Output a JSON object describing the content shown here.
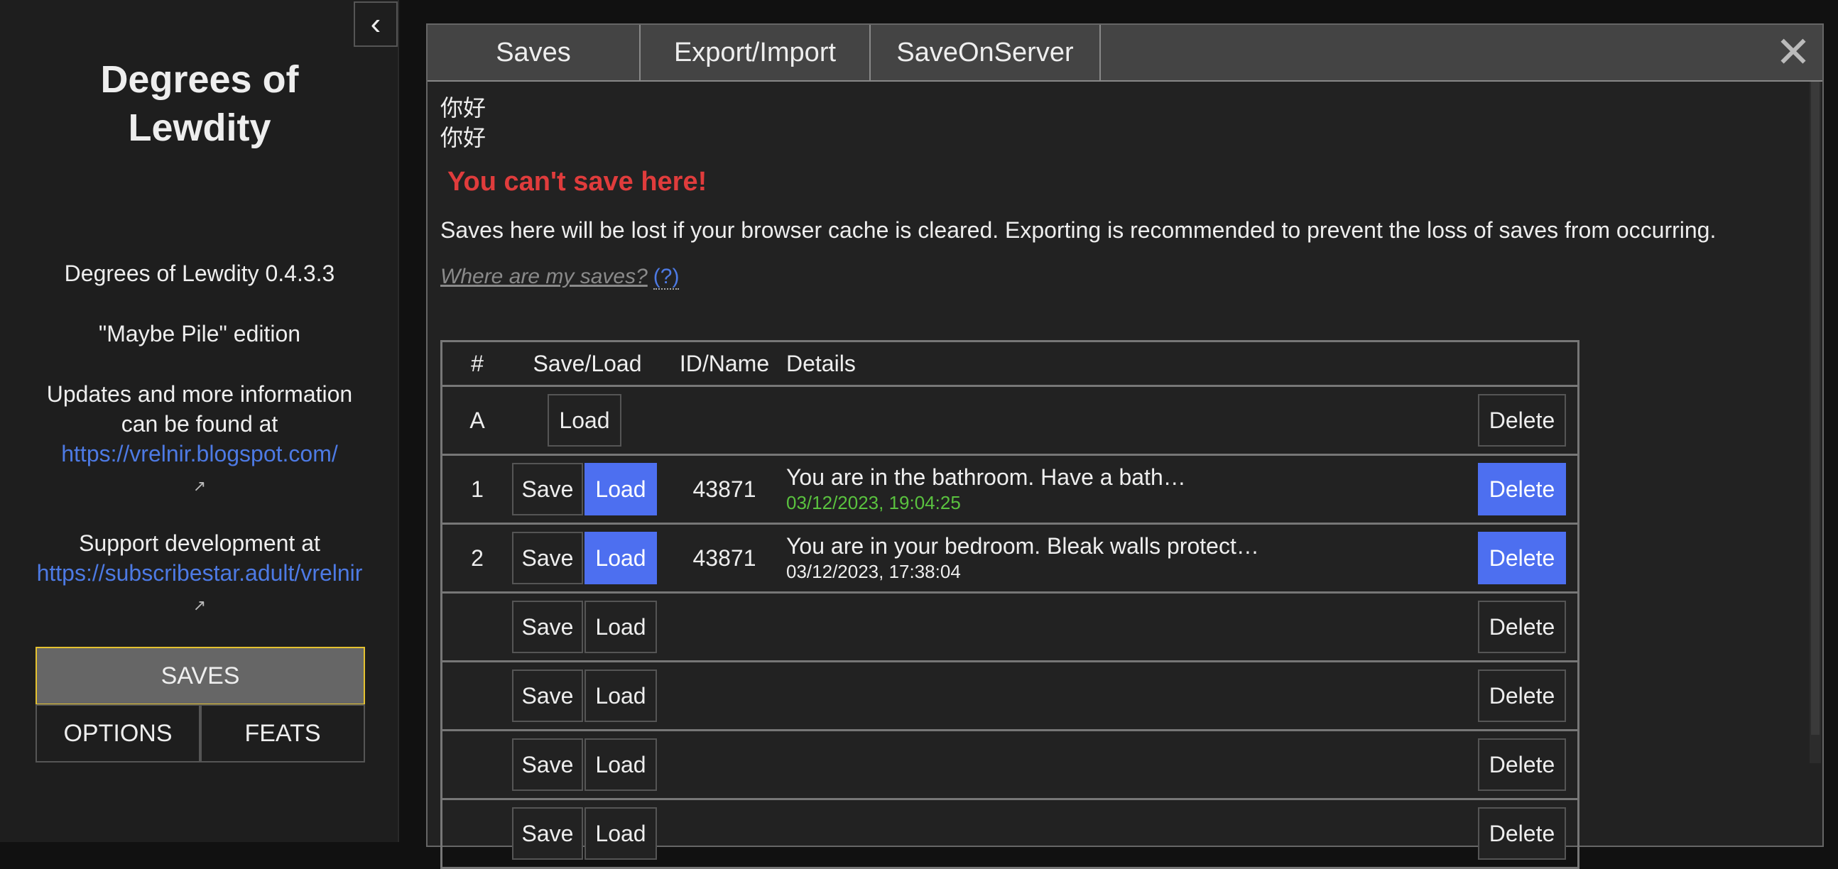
{
  "sidebar": {
    "title": "Degrees of Lewdity",
    "version": "Degrees of Lewdity 0.4.3.3",
    "edition": "\"Maybe Pile\" edition",
    "updates_text": "Updates and more information can be found at",
    "updates_link": "https://vrelnir.blogspot.com/",
    "support_text": "Support development at",
    "support_link": "https://subscribestar.adult/vrelnir",
    "buttons": {
      "saves": "SAVES",
      "options": "OPTIONS",
      "feats": "FEATS"
    }
  },
  "dialog": {
    "tabs": [
      "Saves",
      "Export/Import",
      "SaveOnServer"
    ],
    "lines": [
      "你好",
      "你好"
    ],
    "warning": "You can't save here!",
    "note": "Saves here will be lost if your browser cache is cleared. Exporting is recommended to prevent the loss of saves from occurring.",
    "where_link": "Where are my saves?",
    "help_link": "(?)",
    "table": {
      "headers": [
        "#",
        "Save/Load",
        "ID/Name",
        "Details"
      ],
      "labels": {
        "save": "Save",
        "load": "Load",
        "delete": "Delete"
      },
      "rows": [
        {
          "num": "A",
          "id": "",
          "title": "",
          "date": ""
        },
        {
          "num": "1",
          "id": "43871",
          "title": "You are in the bathroom. Have a bath…",
          "date": "03/12/2023, 19:04:25"
        },
        {
          "num": "2",
          "id": "43871",
          "title": "You are in your bedroom. Bleak walls protect…",
          "date": "03/12/2023, 17:38:04"
        }
      ]
    }
  },
  "colors": {
    "accent": "#4d6ff0",
    "warning": "#e03c3c",
    "highlight": "#e5c230",
    "latest_date": "#5ac23f"
  }
}
